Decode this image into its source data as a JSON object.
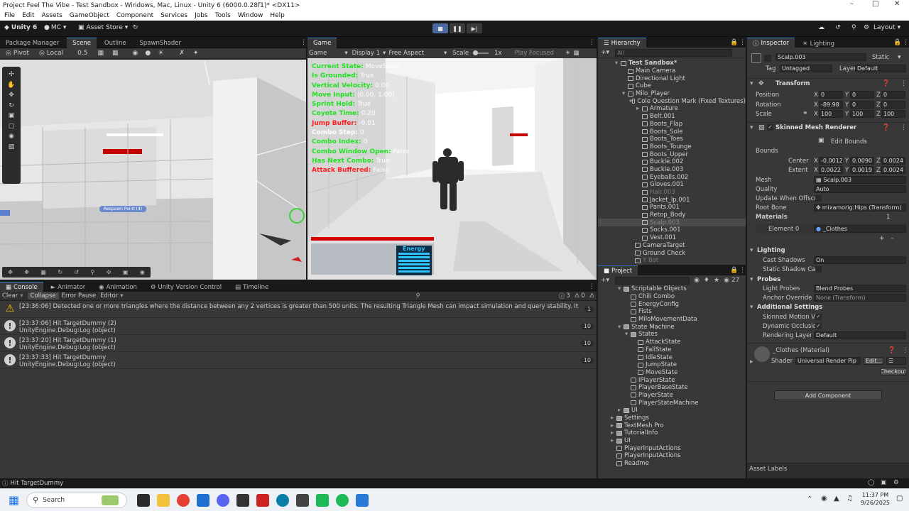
{
  "window": {
    "title": "Project Feel The Vibe - Test Sandbox - Windows, Mac, Linux - Unity 6 (6000.0.28f1)* <DX11>"
  },
  "menu": [
    "File",
    "Edit",
    "Assets",
    "GameObject",
    "Component",
    "Services",
    "Jobs",
    "Tools",
    "Window",
    "Help"
  ],
  "toolbar": {
    "unity": "Unity 6",
    "account": "MC",
    "asset_store": "Asset Store",
    "layout": "Layout"
  },
  "scene_tabs": [
    "Package Manager",
    "Scene",
    "Outline",
    "SpawnShader"
  ],
  "scene_toolbar": {
    "pivot": "Pivot",
    "local": "Local",
    "snap": "0.5"
  },
  "scene_view": {
    "respawn_label": "Respawn Point (4)"
  },
  "game_tab": {
    "label": "Game",
    "mode": "Game",
    "display": "Display 1",
    "aspect": "Free Aspect",
    "scale_label": "Scale",
    "scale_value": "1x",
    "play_focused": "Play Focused"
  },
  "debug_lines": [
    {
      "key": "Current State:",
      "value": "MoveState",
      "color": "green"
    },
    {
      "key": "Is Grounded:",
      "value": "True",
      "color": "green"
    },
    {
      "key": "Vertical Velocity:",
      "value": "0.00",
      "color": "green"
    },
    {
      "key": "Move Input:",
      "value": "(0.00, 1.00)",
      "color": "green"
    },
    {
      "key": "Sprint Held:",
      "value": "True",
      "color": "green"
    },
    {
      "key": "Coyote Time:",
      "value": "0.20",
      "color": "green"
    },
    {
      "key": "Jump Buffer:",
      "value": "-9.01",
      "color": "red"
    },
    {
      "key": "Combo Step:",
      "value": "0",
      "color": "white"
    },
    {
      "key": "Combo Index:",
      "value": "0",
      "color": "green"
    },
    {
      "key": "Combo Window Open:",
      "value": "False",
      "color": "green"
    },
    {
      "key": "Has Next Combo:",
      "value": "True",
      "color": "green"
    },
    {
      "key": "Attack Buffered:",
      "value": "False",
      "color": "red"
    }
  ],
  "hud": {
    "energy_label": "Energy"
  },
  "hierarchy": {
    "title": "Hierarchy",
    "search": "All",
    "items": [
      {
        "label": "Test Sandbox*",
        "depth": 0,
        "bold": true
      },
      {
        "label": "Main Camera",
        "depth": 1
      },
      {
        "label": "Directional Light",
        "depth": 1
      },
      {
        "label": "Cube",
        "depth": 1
      },
      {
        "label": "Milo_Player",
        "depth": 1
      },
      {
        "label": "Cole Question Mark (Fixed Textures)",
        "depth": 2
      },
      {
        "label": "Armature",
        "depth": 3
      },
      {
        "label": "Belt.001",
        "depth": 3
      },
      {
        "label": "Boots_Flap",
        "depth": 3
      },
      {
        "label": "Boots_Sole",
        "depth": 3
      },
      {
        "label": "Boots_Toes",
        "depth": 3
      },
      {
        "label": "Boots_Tounge",
        "depth": 3
      },
      {
        "label": "Boots_Upper",
        "depth": 3
      },
      {
        "label": "Buckle.002",
        "depth": 3
      },
      {
        "label": "Buckle.003",
        "depth": 3
      },
      {
        "label": "Eyeballs.002",
        "depth": 3
      },
      {
        "label": "Gloves.001",
        "depth": 3
      },
      {
        "label": "Hair.003",
        "depth": 3,
        "dim": true
      },
      {
        "label": "Jacket_lp.001",
        "depth": 3
      },
      {
        "label": "Pants.001",
        "depth": 3
      },
      {
        "label": "Retop_Body",
        "depth": 3
      },
      {
        "label": "Scalp.003",
        "depth": 3,
        "selected": true
      },
      {
        "label": "Socks.001",
        "depth": 3
      },
      {
        "label": "Vest.001",
        "depth": 3
      },
      {
        "label": "CameraTarget",
        "depth": 2
      },
      {
        "label": "Ground Check",
        "depth": 2
      },
      {
        "label": "Y Bot",
        "depth": 2,
        "dim": true
      }
    ]
  },
  "project": {
    "title": "Project",
    "count": "27",
    "items": [
      {
        "label": "Scriptable Objects",
        "depth": 1,
        "folder": true
      },
      {
        "label": "Chili Combo",
        "depth": 2
      },
      {
        "label": "EnergyConfig",
        "depth": 2
      },
      {
        "label": "Fists",
        "depth": 2
      },
      {
        "label": "MiloMovementData",
        "depth": 2
      },
      {
        "label": "State Machine",
        "depth": 1,
        "folder": true
      },
      {
        "label": "States",
        "depth": 2,
        "folder": true
      },
      {
        "label": "AttackState",
        "depth": 3
      },
      {
        "label": "FallState",
        "depth": 3
      },
      {
        "label": "IdleState",
        "depth": 3
      },
      {
        "label": "JumpState",
        "depth": 3
      },
      {
        "label": "MoveState",
        "depth": 3
      },
      {
        "label": "IPlayerState",
        "depth": 2
      },
      {
        "label": "PlayerBaseState",
        "depth": 2
      },
      {
        "label": "PlayerState",
        "depth": 2
      },
      {
        "label": "PlayerStateMachine",
        "depth": 2
      },
      {
        "label": "UI",
        "depth": 1,
        "folder": true
      },
      {
        "label": "Settings",
        "depth": 0,
        "folder": true
      },
      {
        "label": "TextMesh Pro",
        "depth": 0,
        "folder": true
      },
      {
        "label": "TutorialInfo",
        "depth": 0,
        "folder": true
      },
      {
        "label": "UI",
        "depth": 0,
        "folder": true
      },
      {
        "label": "PlayerInputActions",
        "depth": 0
      },
      {
        "label": "PlayerInputActions",
        "depth": 0
      },
      {
        "label": "Readme",
        "depth": 0
      }
    ]
  },
  "inspector": {
    "tabs": [
      "Inspector",
      "Lighting"
    ],
    "object_name": "Scalp.003",
    "static_label": "Static",
    "tag_label": "Tag",
    "tag_value": "Untagged",
    "layer_label": "Layer",
    "layer_value": "Default",
    "transform": {
      "title": "Transform",
      "position_label": "Position",
      "position": [
        "0",
        "0",
        "0"
      ],
      "rotation_label": "Rotation",
      "rotation": [
        "-89.98",
        "0",
        "0"
      ],
      "scale_label": "Scale",
      "scale": [
        "100",
        "100",
        "100"
      ]
    },
    "smr": {
      "title": "Skinned Mesh Renderer",
      "edit_bounds": "Edit Bounds",
      "bounds_label": "Bounds",
      "center_label": "Center",
      "center": [
        "-0.0012",
        "0.0090",
        "0.0024"
      ],
      "extent_label": "Extent",
      "extent": [
        "0.0022",
        "0.0019",
        "0.0024"
      ],
      "mesh_label": "Mesh",
      "mesh_value": "Scalp.003",
      "quality_label": "Quality",
      "quality_value": "Auto",
      "update_label": "Update When Offscre",
      "root_bone_label": "Root Bone",
      "root_bone_value": "mixamorig:Hips (Transform)",
      "materials_label": "Materials",
      "materials_count": "1",
      "element0_label": "Element 0",
      "element0_value": "_Clothes",
      "lighting_label": "Lighting",
      "cast_shadows_label": "Cast Shadows",
      "cast_shadows_value": "On",
      "static_shadow_label": "Static Shadow Cas",
      "probes_label": "Probes",
      "light_probes_label": "Light Probes",
      "light_probes_value": "Blend Probes",
      "anchor_label": "Anchor Override",
      "anchor_value": "None (Transform)",
      "additional_label": "Additional Settings",
      "skinned_motion_label": "Skinned Motion Ve",
      "dynamic_occl_label": "Dynamic Occlusio",
      "rendering_layer_label": "Rendering Layer M",
      "rendering_layer_value": "Default"
    },
    "material": {
      "title": "_Clothes (Material)",
      "shader_label": "Shader",
      "shader_value": "Universal Render Pip",
      "edit": "Edit...",
      "checkout": "Checkout"
    },
    "add_component": "Add Component",
    "asset_labels": "Asset Labels"
  },
  "console": {
    "tabs": [
      "Console",
      "Animator",
      "Animation",
      "Unity Version Control",
      "Timeline"
    ],
    "toolbar": {
      "clear": "Clear",
      "collapse": "Collapse",
      "error_pause": "Error Pause",
      "editor": "Editor"
    },
    "warn_count": "3",
    "info_count": "0",
    "entries": [
      {
        "type": "warning",
        "line1": "[23:36:06] Detected one or more triangles where the distance between any 2 vertices is greater than 500 units. The resulting Triangle Mesh can impact simulation and query stability. It is recommended to tesselate",
        "line2": "",
        "count": "1"
      },
      {
        "type": "info",
        "line1": "[23:37:06] Hit TargetDummy (2)",
        "line2": "UnityEngine.Debug:Log (object)",
        "count": "10"
      },
      {
        "type": "info",
        "line1": "[23:37:20] Hit TargetDummy (1)",
        "line2": "UnityEngine.Debug:Log (object)",
        "count": "10"
      },
      {
        "type": "info",
        "line1": "[23:37:33] Hit TargetDummy",
        "line2": "UnityEngine.Debug:Log (object)",
        "count": "10"
      }
    ]
  },
  "status": {
    "text": "Hit TargetDummy"
  },
  "taskbar": {
    "search": "Search",
    "time": "11:37 PM",
    "date": "9/26/2025"
  }
}
